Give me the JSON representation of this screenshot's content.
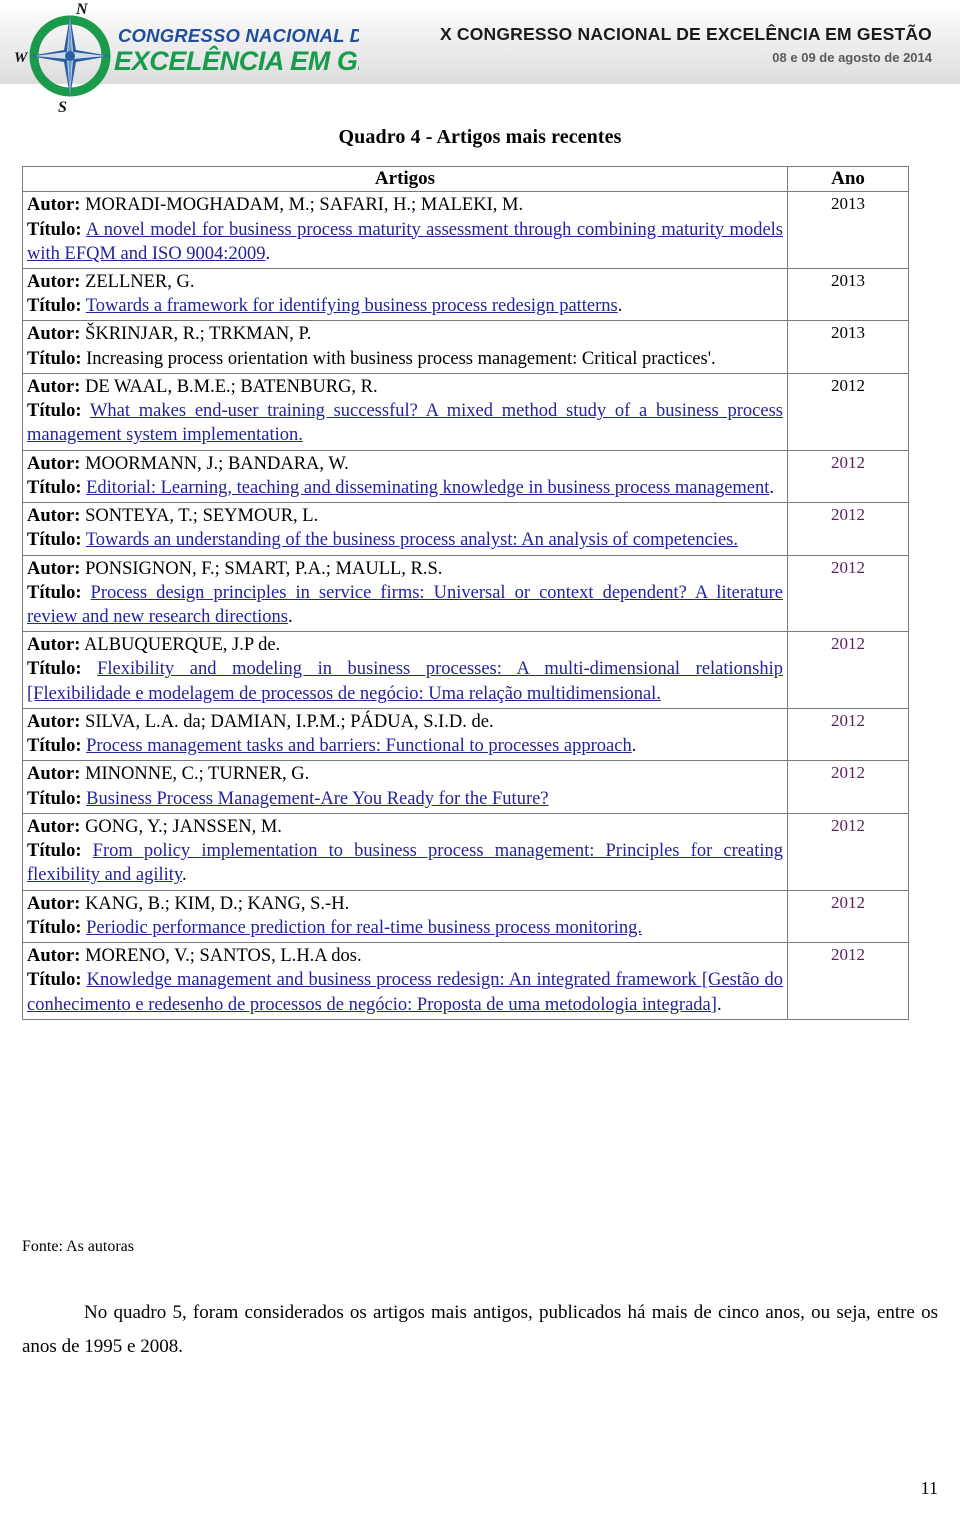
{
  "header": {
    "logo_alt": "Congresso Nacional de Excelencia em Gestao",
    "logo_line1": "CONGRESSO NACIONAL DE",
    "logo_line2": "EXCELÊNCIA EM GESTÃO",
    "compass_n": "N",
    "compass_s": "S",
    "compass_w": "W",
    "congress_title": "X CONGRESSO NACIONAL DE EXCELÊNCIA EM GESTÃO",
    "congress_date": "08 e 09 de agosto de 2014",
    "brand_green": "#1a9a4b",
    "brand_blue": "#1f4e9c"
  },
  "table": {
    "caption": "Quadro 4 - Artigos mais recentes",
    "columns": [
      "Artigos",
      "Ano"
    ],
    "rows": [
      {
        "author_label": "Autor:",
        "author": "MORADI-MOGHADAM, M.; SAFARI, H.; MALEKI, M.",
        "title_label": "Título:",
        "title": "A novel model for business process maturity assessment through combining maturity models with EFQM and ISO 9004:2009",
        "title_is_link": true,
        "title_trailing": ".",
        "year": "2013",
        "year_visited": false
      },
      {
        "author_label": "Autor:",
        "author": "ZELLNER, G.",
        "title_label": "Título:",
        "title": "Towards a framework for identifying business process redesign patterns",
        "title_is_link": true,
        "title_trailing": ".",
        "year": "2013",
        "year_visited": false
      },
      {
        "author_label": "Autor:",
        "author": "ŠKRINJAR, R.; TRKMAN, P.",
        "title_label": "Título:",
        "title": "Increasing process orientation with business process management: Critical practices'.",
        "title_is_link": false,
        "title_trailing": "",
        "year": "2013",
        "year_visited": false
      },
      {
        "author_label": "Autor:",
        "author": "DE WAAL, B.M.E.; BATENBURG, R.",
        "title_label": "Título:",
        "title": "What makes end-user training successful? A mixed method study of a business process management system implementation.",
        "title_is_link": true,
        "title_trailing": "",
        "year": "2012",
        "year_visited": false
      },
      {
        "author_label": "Autor:",
        "author": "MOORMANN, J.; BANDARA, W.",
        "title_label": "Título:",
        "title": "Editorial: Learning, teaching and disseminating knowledge in business process management",
        "title_is_link": true,
        "title_trailing": ".",
        "year": "2012",
        "year_visited": true
      },
      {
        "author_label": "Autor:",
        "author": "SONTEYA, T.; SEYMOUR, L.",
        "title_label": "Título:",
        "title": "Towards an understanding of the business process analyst: An analysis of competencies.",
        "title_is_link": true,
        "title_trailing": "",
        "year": "2012",
        "year_visited": true
      },
      {
        "author_label": "Autor:",
        "author": "PONSIGNON, F.; SMART, P.A.; MAULL, R.S.",
        "title_label": "Título:",
        "title": "Process design principles in service firms: Universal or context dependent? A literature review and new research directions",
        "title_is_link": true,
        "title_trailing": ".",
        "year": "2012",
        "year_visited": true
      },
      {
        "author_label": "Autor:",
        "author": "ALBUQUERQUE, J.P de.",
        "title_label": "Título:",
        "title": "Flexibility and modeling in business processes: A multi-dimensional relationship [Flexibilidade e modelagem de processos de negócio: Uma relação multidimensional.",
        "title_is_link": true,
        "title_trailing": "",
        "year": "2012",
        "year_visited": true
      },
      {
        "author_label": "Autor:",
        "author": "SILVA, L.A. da; DAMIAN, I.P.M.; PÁDUA, S.I.D. de.",
        "title_label": "Título:",
        "title": "Process management tasks and barriers: Functional to processes approach",
        "title_is_link": true,
        "title_trailing": ".",
        "year": "2012",
        "year_visited": true
      },
      {
        "author_label": "Autor:",
        "author": "MINONNE, C.; TURNER, G.",
        "title_label": "Título:",
        "title": "Business Process Management-Are You Ready for the Future?",
        "title_is_link": true,
        "title_trailing": "",
        "year": "2012",
        "year_visited": true
      },
      {
        "author_label": "Autor:",
        "author": "GONG, Y.; JANSSEN, M.",
        "title_label": "Título:",
        "title": "From policy implementation to business process management: Principles for creating flexibility and agility",
        "title_is_link": true,
        "title_trailing": ".",
        "year": "2012",
        "year_visited": true
      },
      {
        "author_label": "Autor:",
        "author": "KANG, B.; KIM, D.; KANG, S.-H.",
        "title_label": "Título:",
        "title": "Periodic performance prediction for real-time business process monitoring.",
        "title_is_link": true,
        "title_trailing": "",
        "year": "2012",
        "year_visited": true
      },
      {
        "author_label": "Autor:",
        "author": "MORENO, V.; SANTOS, L.H.A dos.",
        "title_label": "Título:",
        "title": "Knowledge management and business process redesign: An integrated framework [Gestão do conhecimento e redesenho de processos de negócio: Proposta de uma metodologia integrada]",
        "title_is_link": true,
        "title_trailing": ".",
        "year": "2012",
        "year_visited": true
      }
    ]
  },
  "fonte": "Fonte: As autoras",
  "body_paragraph": "No quadro 5,  foram considerados os artigos mais antigos, publicados há mais de cinco anos, ou seja, entre os anos de 1995 e 2008.",
  "page_number": "11"
}
